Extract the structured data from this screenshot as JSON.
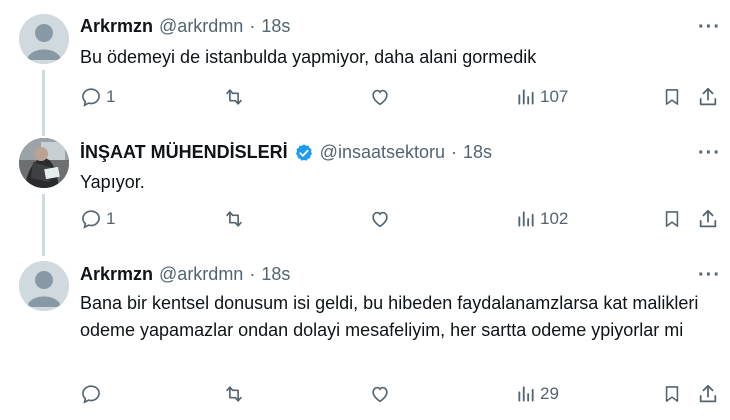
{
  "tweets": [
    {
      "name": "Arkrmzn",
      "handle": "@arkrdmn",
      "separator": "·",
      "time": "18s",
      "text": "Bu ödemeyi de istanbulda yapmiyor, daha alani gormedik",
      "replies": "1",
      "retweets": "",
      "likes": "",
      "views": "107",
      "avatar_icon": "default-avatar-icon"
    },
    {
      "name": "İNŞAAT MÜHENDİSLERİ",
      "handle": "@insaatsektoru",
      "separator": "·",
      "time": "18s",
      "verified": true,
      "text": "Yapıyor.",
      "replies": "1",
      "retweets": "",
      "likes": "",
      "views": "102",
      "avatar_icon": "profile-photo"
    },
    {
      "name": "Arkrmzn",
      "handle": "@arkrdmn",
      "separator": "·",
      "time": "18s",
      "text": "Bana bir kentsel donusum isi geldi, bu hibeden faydalanamzlarsa kat malikleri odeme yapamazlar ondan dolayi mesafeliyim, her sartta odeme ypiyorlar mi",
      "replies": "",
      "retweets": "",
      "likes": "",
      "views": "29",
      "avatar_icon": "default-avatar-icon"
    }
  ],
  "more_label": "···",
  "colors": {
    "text": "#0f1419",
    "secondary": "#536471",
    "verified": "#1d9bf0",
    "thread_line": "#cfd9de",
    "avatar_bg": "#d1d9dd"
  }
}
